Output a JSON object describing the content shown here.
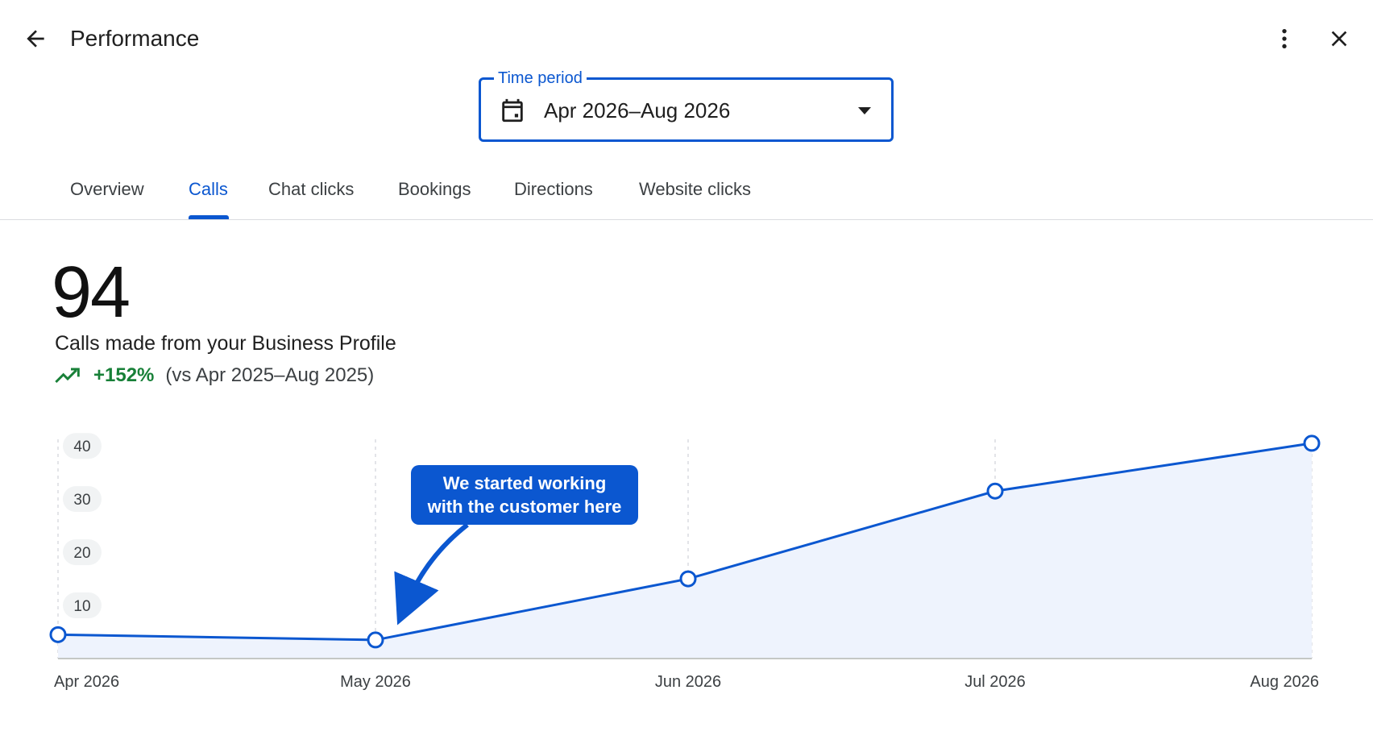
{
  "header": {
    "title": "Performance",
    "back_icon": "arrow-back-icon",
    "more_icon": "more-vert-icon",
    "close_icon": "close-icon"
  },
  "time_period": {
    "label": "Time period",
    "value": "Apr 2026–Aug 2026",
    "icon": "calendar-icon"
  },
  "tabs": [
    {
      "label": "Overview",
      "active": false
    },
    {
      "label": "Calls",
      "active": true
    },
    {
      "label": "Chat clicks",
      "active": false
    },
    {
      "label": "Bookings",
      "active": false
    },
    {
      "label": "Directions",
      "active": false
    },
    {
      "label": "Website clicks",
      "active": false
    }
  ],
  "metric": {
    "value": "94",
    "description": "Calls made from your Business Profile",
    "trend_icon": "trending-up-icon",
    "change": "+152%",
    "comparison": "(vs Apr 2025–Aug 2025)"
  },
  "callout": {
    "line1": "We started working",
    "line2": "with the customer here"
  },
  "colors": {
    "accent": "#0b57d0",
    "positive": "#188038",
    "area_fill": "#eef3fd"
  },
  "chart_data": {
    "type": "area",
    "categories": [
      "Apr 2026",
      "May 2026",
      "Jun 2026",
      "Jul 2026",
      "Aug 2026"
    ],
    "series": [
      {
        "values": [
          4.5,
          3.5,
          15,
          31.5,
          40.5
        ]
      }
    ],
    "yticks": [
      10,
      20,
      30,
      40
    ],
    "ylim": [
      0,
      42
    ],
    "grid": "vertical-dashed",
    "annotation": {
      "category": "May 2026",
      "text": "We started working with the customer here"
    }
  }
}
